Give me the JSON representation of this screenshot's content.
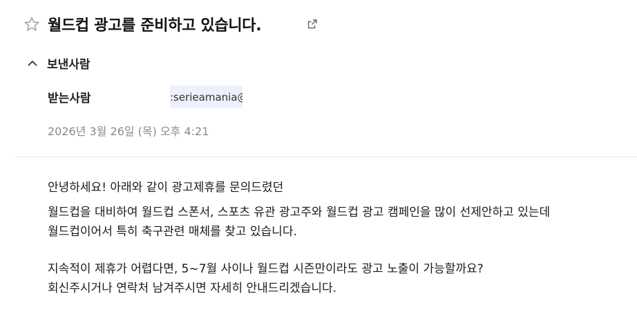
{
  "subject": "월드컵 광고를 준비하고 있습니다.",
  "sender_section_label": "보낸사람",
  "recipient_label": "받는사람",
  "recipient_value": ":serieamania@",
  "date": "2026년 3월 26일 (목) 오후 4:21",
  "body": {
    "line1": "안녕하세요! 아래와 같이 광고제휴를 문의드렸던",
    "line2": "월드컵을 대비하여 월드컵 스폰서, 스포츠 유관 광고주와 월드컵 광고 캠페인을 많이 선제안하고 있는데",
    "line3": "월드컵이어서 특히 축구관련 매체를 찾고 있습니다.",
    "line4": "지속적이 제휴가 어렵다면, 5~7월 사이나 월드컵 시즌만이라도             광고 노출이 가능할까요?",
    "line5": "회신주시거나 연락처 남겨주시면 자세히 안내드리겠습니다."
  },
  "icons": {
    "star": "star-outline-icon",
    "external": "external-link-icon",
    "chevron": "chevron-up-icon"
  },
  "colors": {
    "chip_bg": "#eef1fb",
    "date_text": "#8a8a8a"
  }
}
